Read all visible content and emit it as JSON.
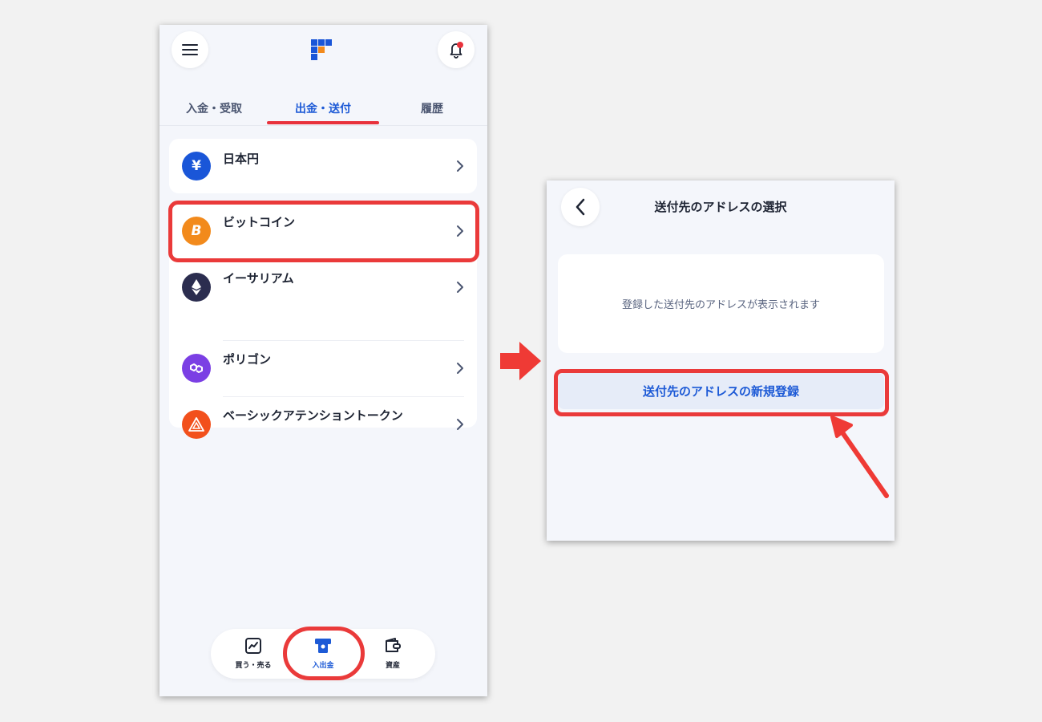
{
  "left_screen": {
    "tabs": [
      {
        "label": "入金・受取"
      },
      {
        "label": "出金・送付"
      },
      {
        "label": "履歴"
      }
    ],
    "active_tab": "出金・送付",
    "currencies": [
      {
        "label": "日本円",
        "symbol": "¥",
        "color": "#1a56d8"
      },
      {
        "label": "ビットコイン",
        "symbol": "B",
        "color": "#f28a1c"
      },
      {
        "label": "イーサリアム",
        "symbol": "",
        "color": "#2b2d4f"
      },
      {
        "label": "ポリゴン",
        "symbol": "",
        "color": "#7b3fe4"
      },
      {
        "label": "ベーシックアテンショントークン",
        "symbol": "",
        "color": "#f2501c"
      }
    ],
    "bottom_nav": [
      {
        "label": "買う・売る",
        "icon": "chart-icon"
      },
      {
        "label": "入出金",
        "icon": "deposit-withdraw-icon"
      },
      {
        "label": "資産",
        "icon": "wallet-icon"
      }
    ],
    "active_nav": "入出金"
  },
  "right_screen": {
    "title": "送付先のアドレスの選択",
    "empty_message": "登録した送付先のアドレスが表示されます",
    "new_address_button": "送付先のアドレスの新規登録"
  },
  "colors": {
    "accent_blue": "#1d5ad6",
    "highlight_red": "#ea3a3a",
    "background": "#f4f6fb"
  }
}
